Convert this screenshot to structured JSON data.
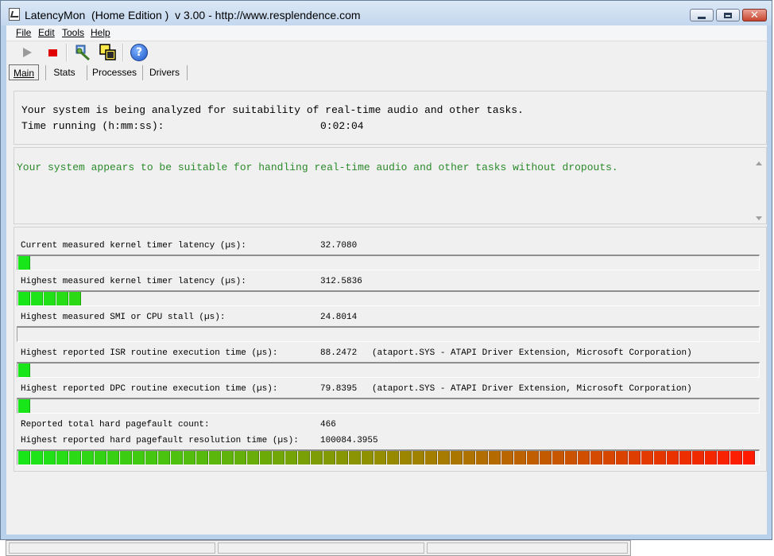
{
  "window": {
    "title": "LatencyMon  (Home Edition )  v 3.00 - http://www.resplendence.com"
  },
  "menu": [
    {
      "label": "File"
    },
    {
      "label": "Edit"
    },
    {
      "label": "Tools"
    },
    {
      "label": "Help"
    }
  ],
  "toolbar": {
    "icons": [
      "play-icon",
      "stop-icon",
      "wrench-icon",
      "windows-icon",
      "help-icon"
    ],
    "help_glyph": "?"
  },
  "tabs": [
    {
      "label": "Main",
      "active": true
    },
    {
      "label": "Stats"
    },
    {
      "label": "Processes"
    },
    {
      "label": "Drivers"
    }
  ],
  "summary": {
    "line1": "Your system is being analyzed for suitability of real-time audio and other tasks.",
    "time_label": "Time running (h:mm:ss):",
    "time_value": "0:02:04"
  },
  "verdict": {
    "text": "Your system appears to be suitable for handling real-time audio and other tasks without dropouts.",
    "color": "#2a8a2a"
  },
  "metrics": [
    {
      "label": "Current measured kernel timer latency (µs):",
      "value": "32.7080",
      "detail": "",
      "level_segments": 1
    },
    {
      "label": "Highest measured kernel timer latency (µs):",
      "value": "312.5836",
      "detail": "",
      "level_segments": 5
    },
    {
      "label": "Highest measured SMI or CPU stall (µs):",
      "value": "24.8014",
      "detail": "",
      "level_segments": 0
    },
    {
      "label": "Highest reported ISR routine execution time (µs):",
      "value": "88.2472",
      "detail": "(ataport.SYS - ATAPI Driver Extension, Microsoft Corporation)",
      "level_segments": 1
    },
    {
      "label": "Highest reported DPC routine execution time (µs):",
      "value": "79.8395",
      "detail": "(ataport.SYS - ATAPI Driver Extension, Microsoft Corporation)",
      "level_segments": 1
    }
  ],
  "pagefault": {
    "count_label": "Reported total hard pagefault count:",
    "count_value": "466",
    "time_label": "Highest reported hard pagefault resolution time (µs):",
    "time_value": "100084.3955",
    "level_segments": 59
  },
  "colors": {
    "bar_green": "#19e619",
    "bar_red": "#ff1a00",
    "window_frame": "#b9d1ea"
  }
}
